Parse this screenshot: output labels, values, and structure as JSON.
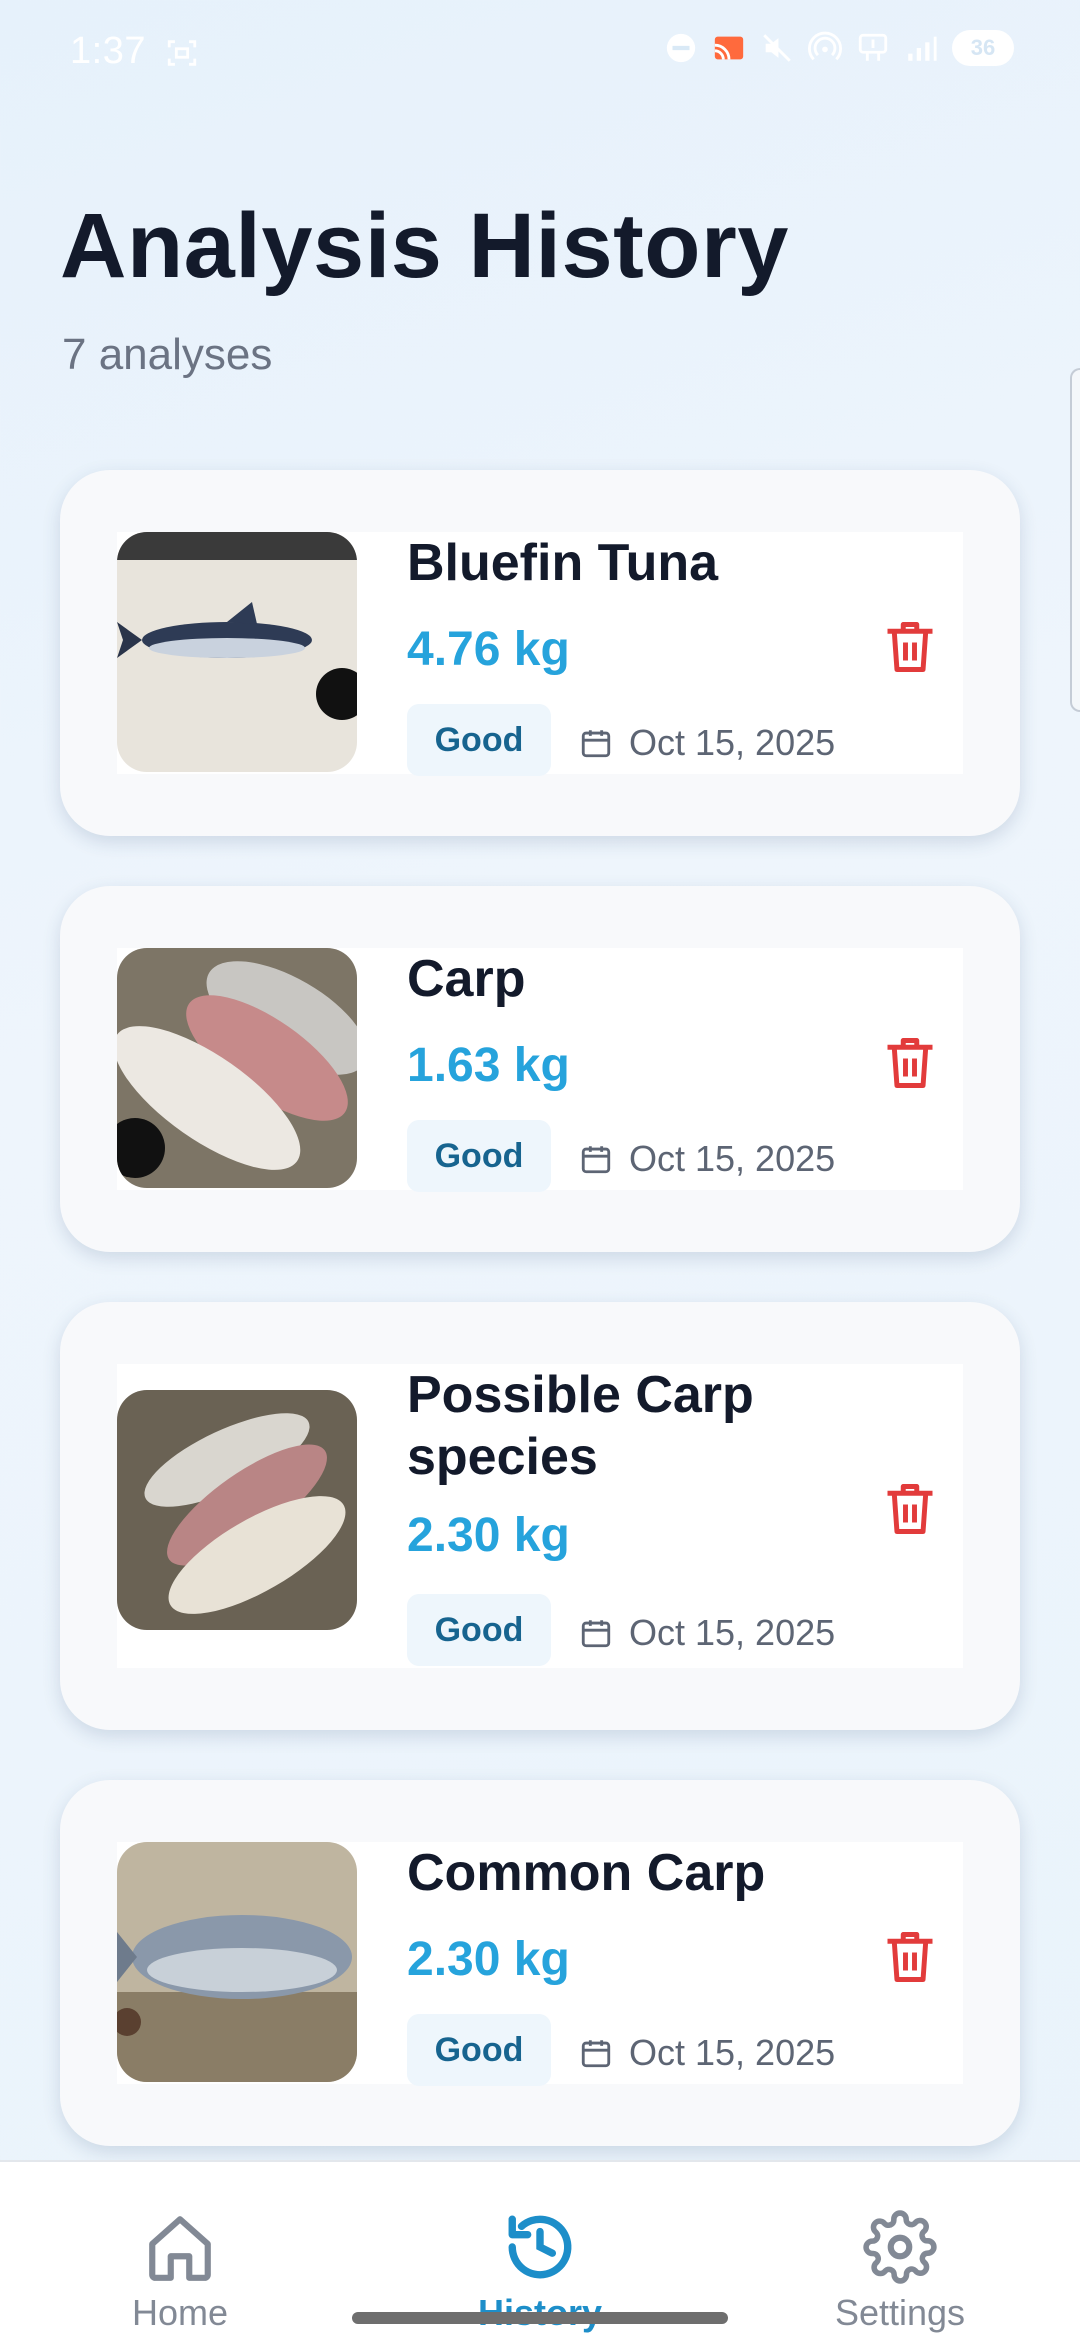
{
  "status_bar": {
    "time": "1:37",
    "battery": "36",
    "icons": [
      "focus-icon",
      "dnd-icon",
      "cast-icon",
      "mute-icon",
      "hotspot-icon",
      "data-icon",
      "signal-icon"
    ]
  },
  "header": {
    "title": "Analysis History",
    "subtitle": "7 analyses"
  },
  "analyses": [
    {
      "name": "Bluefin Tuna",
      "weight": "4.76 kg",
      "quality": "Good",
      "date": "Oct 15, 2025"
    },
    {
      "name": "Carp",
      "weight": "1.63 kg",
      "quality": "Good",
      "date": "Oct 15, 2025"
    },
    {
      "name": "Possible Carp species",
      "weight": "2.30 kg",
      "quality": "Good",
      "date": "Oct 15, 2025"
    },
    {
      "name": "Common Carp",
      "weight": "2.30 kg",
      "quality": "Good",
      "date": "Oct 15, 2025"
    }
  ],
  "nav": {
    "items": [
      {
        "label": "Home",
        "icon": "home-icon"
      },
      {
        "label": "History",
        "icon": "history-icon",
        "active": true
      },
      {
        "label": "Settings",
        "icon": "gear-icon"
      }
    ]
  },
  "colors": {
    "accent": "#26a3dc",
    "nav_active": "#1d8ec9",
    "delete": "#e23b3b",
    "badge_bg": "#eef6fc",
    "badge_text": "#17648f"
  }
}
